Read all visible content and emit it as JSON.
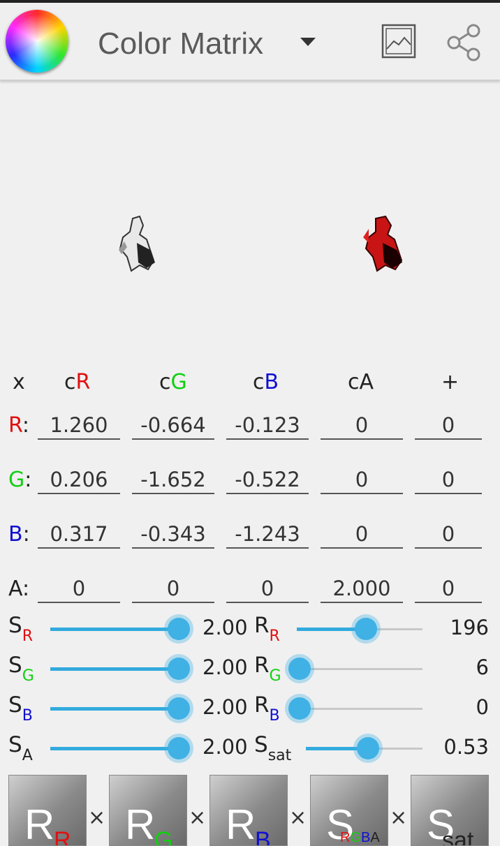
{
  "app": {
    "title": "Color Matrix",
    "icon": "color-wheel-icon",
    "actions": [
      {
        "name": "image-icon"
      },
      {
        "name": "share-icon"
      }
    ]
  },
  "matrix": {
    "headers": [
      "x",
      "cR",
      "cG",
      "cB",
      "cA",
      "+"
    ],
    "header_colors": [
      "#222222",
      "#e01010",
      "#10d010",
      "#1010d0",
      "#222222",
      "#222222"
    ],
    "rows": [
      {
        "label": "R",
        "label_color": "#e01010",
        "values": [
          "1.260",
          "-0.664",
          "-0.123",
          "0",
          "0"
        ]
      },
      {
        "label": "G",
        "label_color": "#10d010",
        "values": [
          "0.206",
          "-1.652",
          "-0.522",
          "0",
          "0"
        ]
      },
      {
        "label": "B",
        "label_color": "#1010d0",
        "values": [
          "0.317",
          "-0.343",
          "-1.243",
          "0",
          "0"
        ]
      },
      {
        "label": "A",
        "label_color": "#222222",
        "values": [
          "0",
          "0",
          "0",
          "2.000",
          "0"
        ]
      }
    ]
  },
  "sliders_left": [
    {
      "letter": "S",
      "sub": "R",
      "sub_color": "#e01010",
      "value": "2.00",
      "fraction": 1.0
    },
    {
      "letter": "S",
      "sub": "G",
      "sub_color": "#10d010",
      "value": "2.00",
      "fraction": 1.0
    },
    {
      "letter": "S",
      "sub": "B",
      "sub_color": "#1010d0",
      "value": "2.00",
      "fraction": 1.0
    },
    {
      "letter": "S",
      "sub": "A",
      "sub_color": "#222222",
      "value": "2.00",
      "fraction": 1.0
    }
  ],
  "sliders_right": [
    {
      "letter": "R",
      "sub": "R",
      "sub_color": "#e01010",
      "value": "196",
      "fraction": 0.55
    },
    {
      "letter": "R",
      "sub": "G",
      "sub_color": "#10d010",
      "value": "6",
      "fraction": 0.02
    },
    {
      "letter": "R",
      "sub": "B",
      "sub_color": "#1010d0",
      "value": "0",
      "fraction": 0.0
    },
    {
      "letter": "S",
      "sub": "sat",
      "sub_color": "#222222",
      "value": "0.53",
      "fraction": 0.53
    }
  ],
  "buttons": [
    {
      "main": "R",
      "sub": "R",
      "sub_color": "#e01010"
    },
    {
      "main": "R",
      "sub": "G",
      "sub_color": "#10d010"
    },
    {
      "main": "R",
      "sub": "B",
      "sub_color": "#1010d0"
    },
    {
      "main": "S",
      "sub_parts": [
        {
          "t": "R",
          "c": "#e01010"
        },
        {
          "t": "G",
          "c": "#10d010"
        },
        {
          "t": "B",
          "c": "#1010d0"
        },
        {
          "t": "A",
          "c": "#222222"
        }
      ]
    },
    {
      "main": "S",
      "sub": "sat",
      "sub_color": "#222222"
    }
  ],
  "operator": "×",
  "accent_color": "#3fb1e5"
}
